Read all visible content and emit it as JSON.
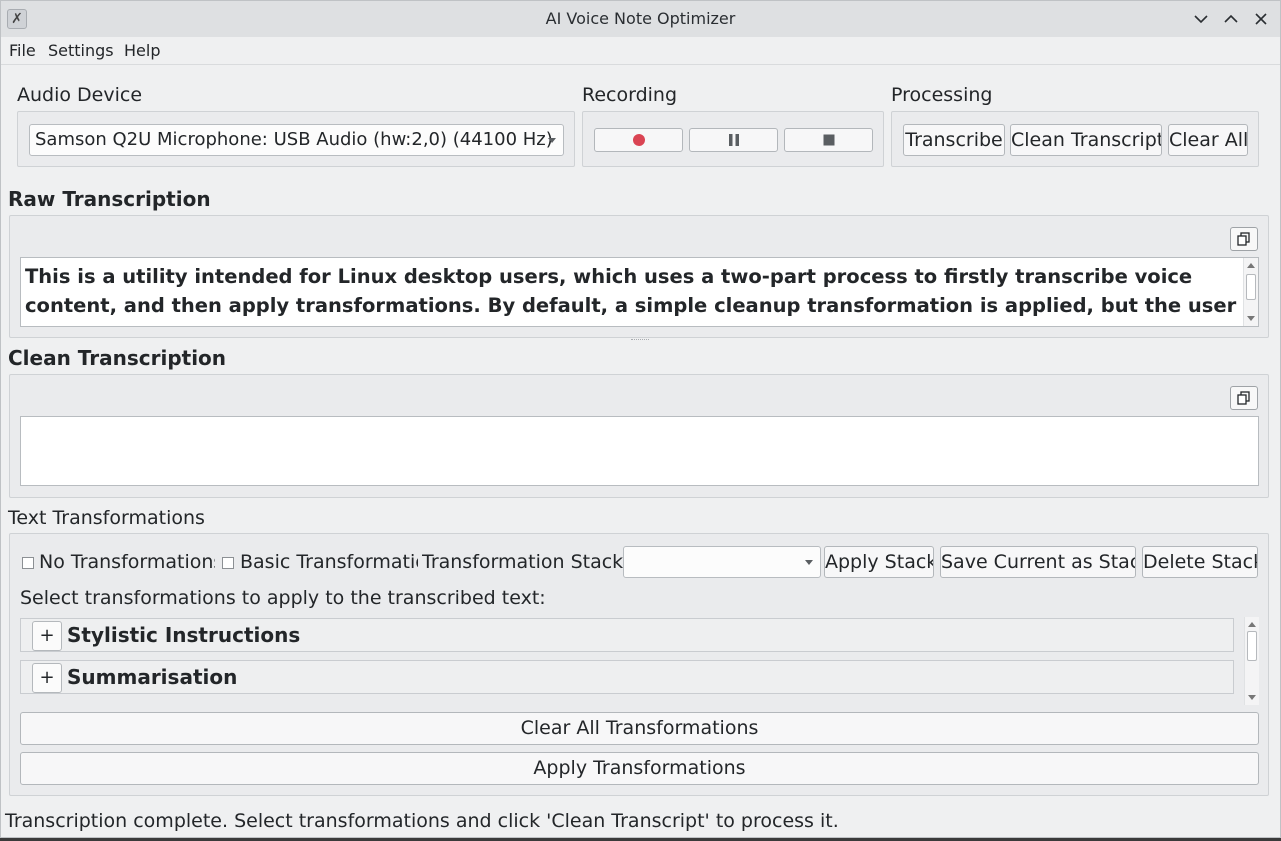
{
  "window": {
    "title": "AI Voice Note Optimizer"
  },
  "menu": {
    "file": "File",
    "settings": "Settings",
    "help": "Help"
  },
  "audio_device": {
    "label": "Audio Device",
    "selected": "Samson Q2U Microphone: USB Audio (hw:2,0) (44100 Hz)"
  },
  "recording": {
    "label": "Recording"
  },
  "processing": {
    "label": "Processing",
    "transcribe": "Transcribe",
    "clean": "Clean Transcript",
    "clear_all": "Clear All"
  },
  "raw": {
    "title": "Raw Transcription",
    "text": "This is a utility intended for Linux desktop users, which uses a two-part process to firstly transcribe voice content, and then apply transformations. By default, a simple cleanup transformation is applied, but the user can choose to"
  },
  "clean": {
    "title": "Clean Transcription",
    "text": ""
  },
  "transformations": {
    "title": "Text Transformations",
    "no_transformations": "No Transformations",
    "basic_transformations": "Basic Transformatio",
    "stack_label": "Transformation Stack:",
    "stack_value": "",
    "apply_stack": "Apply Stack",
    "save_stack": "Save Current as Stack",
    "delete_stack": "Delete Stack",
    "instruction": "Select transformations to apply to the transcribed text:",
    "categories": [
      {
        "expander": "+",
        "label": "Stylistic Instructions"
      },
      {
        "expander": "+",
        "label": "Summarisation"
      }
    ],
    "clear_all": "Clear All Transformations",
    "apply": "Apply Transformations"
  },
  "status": "Transcription complete. Select transformations and click 'Clean Transcript' to process it.",
  "colors": {
    "record_dot": "#da4453",
    "window_bg": "#eff0f1",
    "titlebar_bg": "#dee0e2"
  },
  "icons": {
    "app": "app-x-icon",
    "minimize": "chevron-down-icon",
    "maximize": "chevron-up-icon",
    "close": "close-icon",
    "record": "record-icon",
    "pause": "pause-icon",
    "stop": "stop-icon",
    "copy": "copy-icon"
  }
}
